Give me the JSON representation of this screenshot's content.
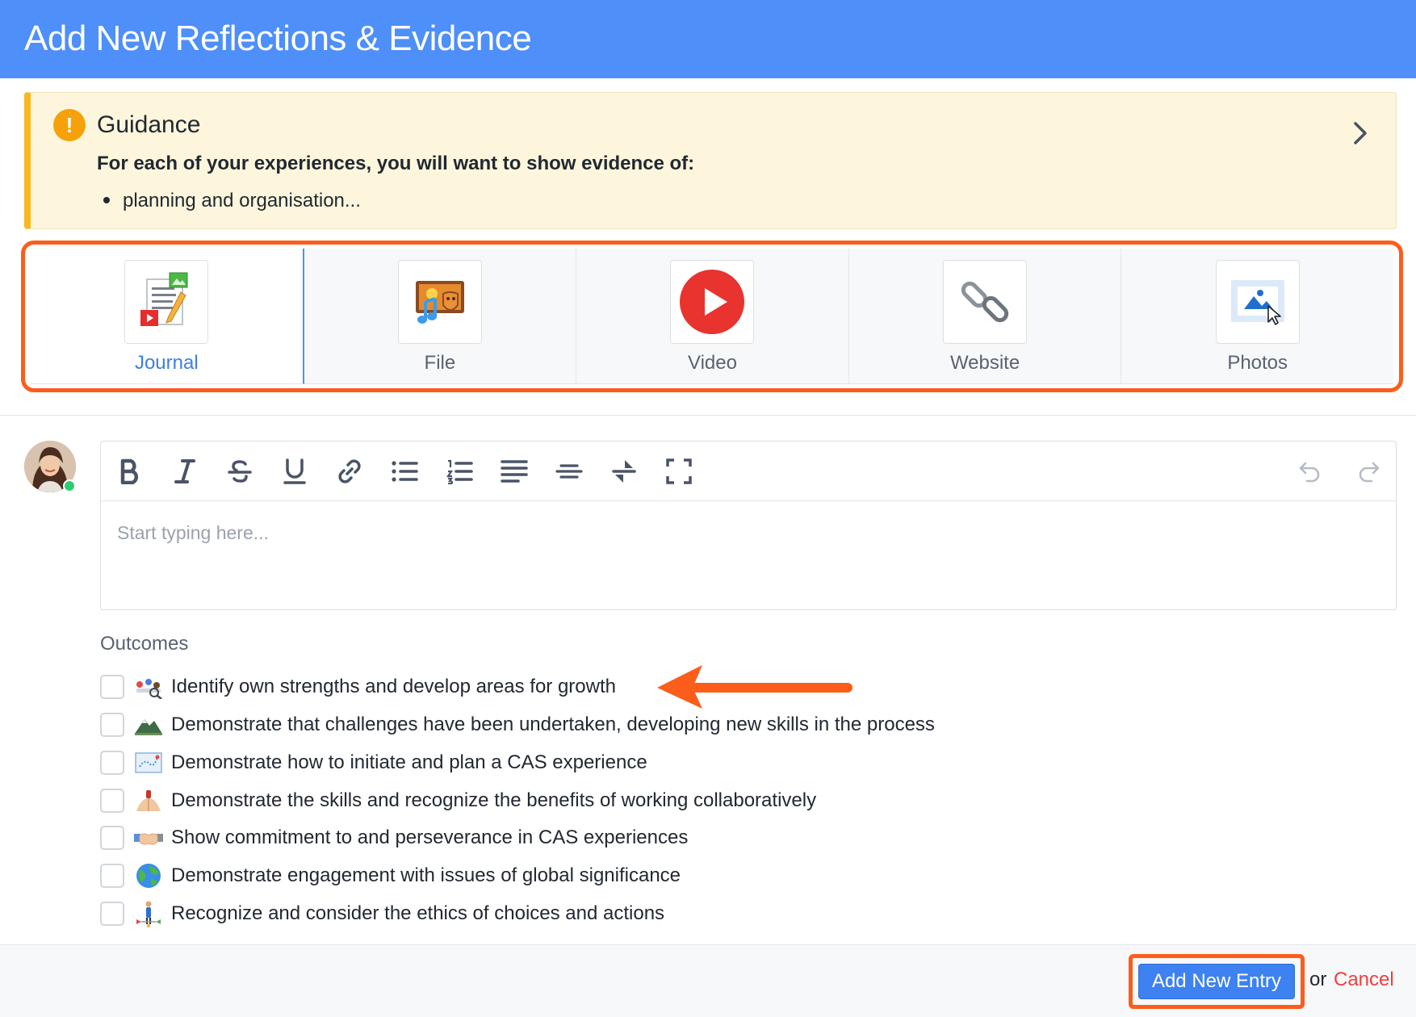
{
  "header": {
    "title": "Add New Reflections & Evidence"
  },
  "guidance": {
    "title": "Guidance",
    "icon": "exclamation-icon",
    "lead": "For each of your experiences, you will want to show evidence of:",
    "bullet": "planning and organisation..."
  },
  "entry_types": [
    {
      "label": "Journal",
      "icon": "journal-icon",
      "active": true
    },
    {
      "label": "File",
      "icon": "file-icon",
      "active": false
    },
    {
      "label": "Video",
      "icon": "video-play-icon",
      "active": false
    },
    {
      "label": "Website",
      "icon": "link-icon",
      "active": false
    },
    {
      "label": "Photos",
      "icon": "photos-icon",
      "active": false
    }
  ],
  "editor": {
    "placeholder": "Start typing here...",
    "toolbar": [
      "bold",
      "italic",
      "strikethrough",
      "underline",
      "link",
      "bullet-list",
      "numbered-list",
      "align-justify",
      "align-center",
      "reverse",
      "fullscreen",
      "undo",
      "redo"
    ]
  },
  "outcomes": {
    "title": "Outcomes",
    "items": [
      {
        "text": "Identify own strengths and develop areas for growth",
        "icon": "strengths-icon"
      },
      {
        "text": "Demonstrate that challenges have been undertaken, developing new skills in the process",
        "icon": "mountain-icon"
      },
      {
        "text": "Demonstrate how to initiate and plan a CAS experience",
        "icon": "map-icon"
      },
      {
        "text": "Demonstrate the skills and recognize the benefits of working collaboratively",
        "icon": "collaboration-icon"
      },
      {
        "text": "Show commitment to and perseverance in CAS experiences",
        "icon": "handshake-icon"
      },
      {
        "text": "Demonstrate engagement with issues of global significance",
        "icon": "globe-icon"
      },
      {
        "text": "Recognize and consider the ethics of choices and actions",
        "icon": "ethics-icon"
      }
    ]
  },
  "footer": {
    "submit_label": "Add New Entry",
    "or_text": "or",
    "cancel_label": "Cancel"
  },
  "colors": {
    "header": "#4e8ff9",
    "guidance_bg": "#fdf6dc",
    "guidance_accent": "#f9b820",
    "annotation": "#fd5d1b",
    "primary_button": "#3d82f0",
    "cancel": "#ef3f3f"
  }
}
